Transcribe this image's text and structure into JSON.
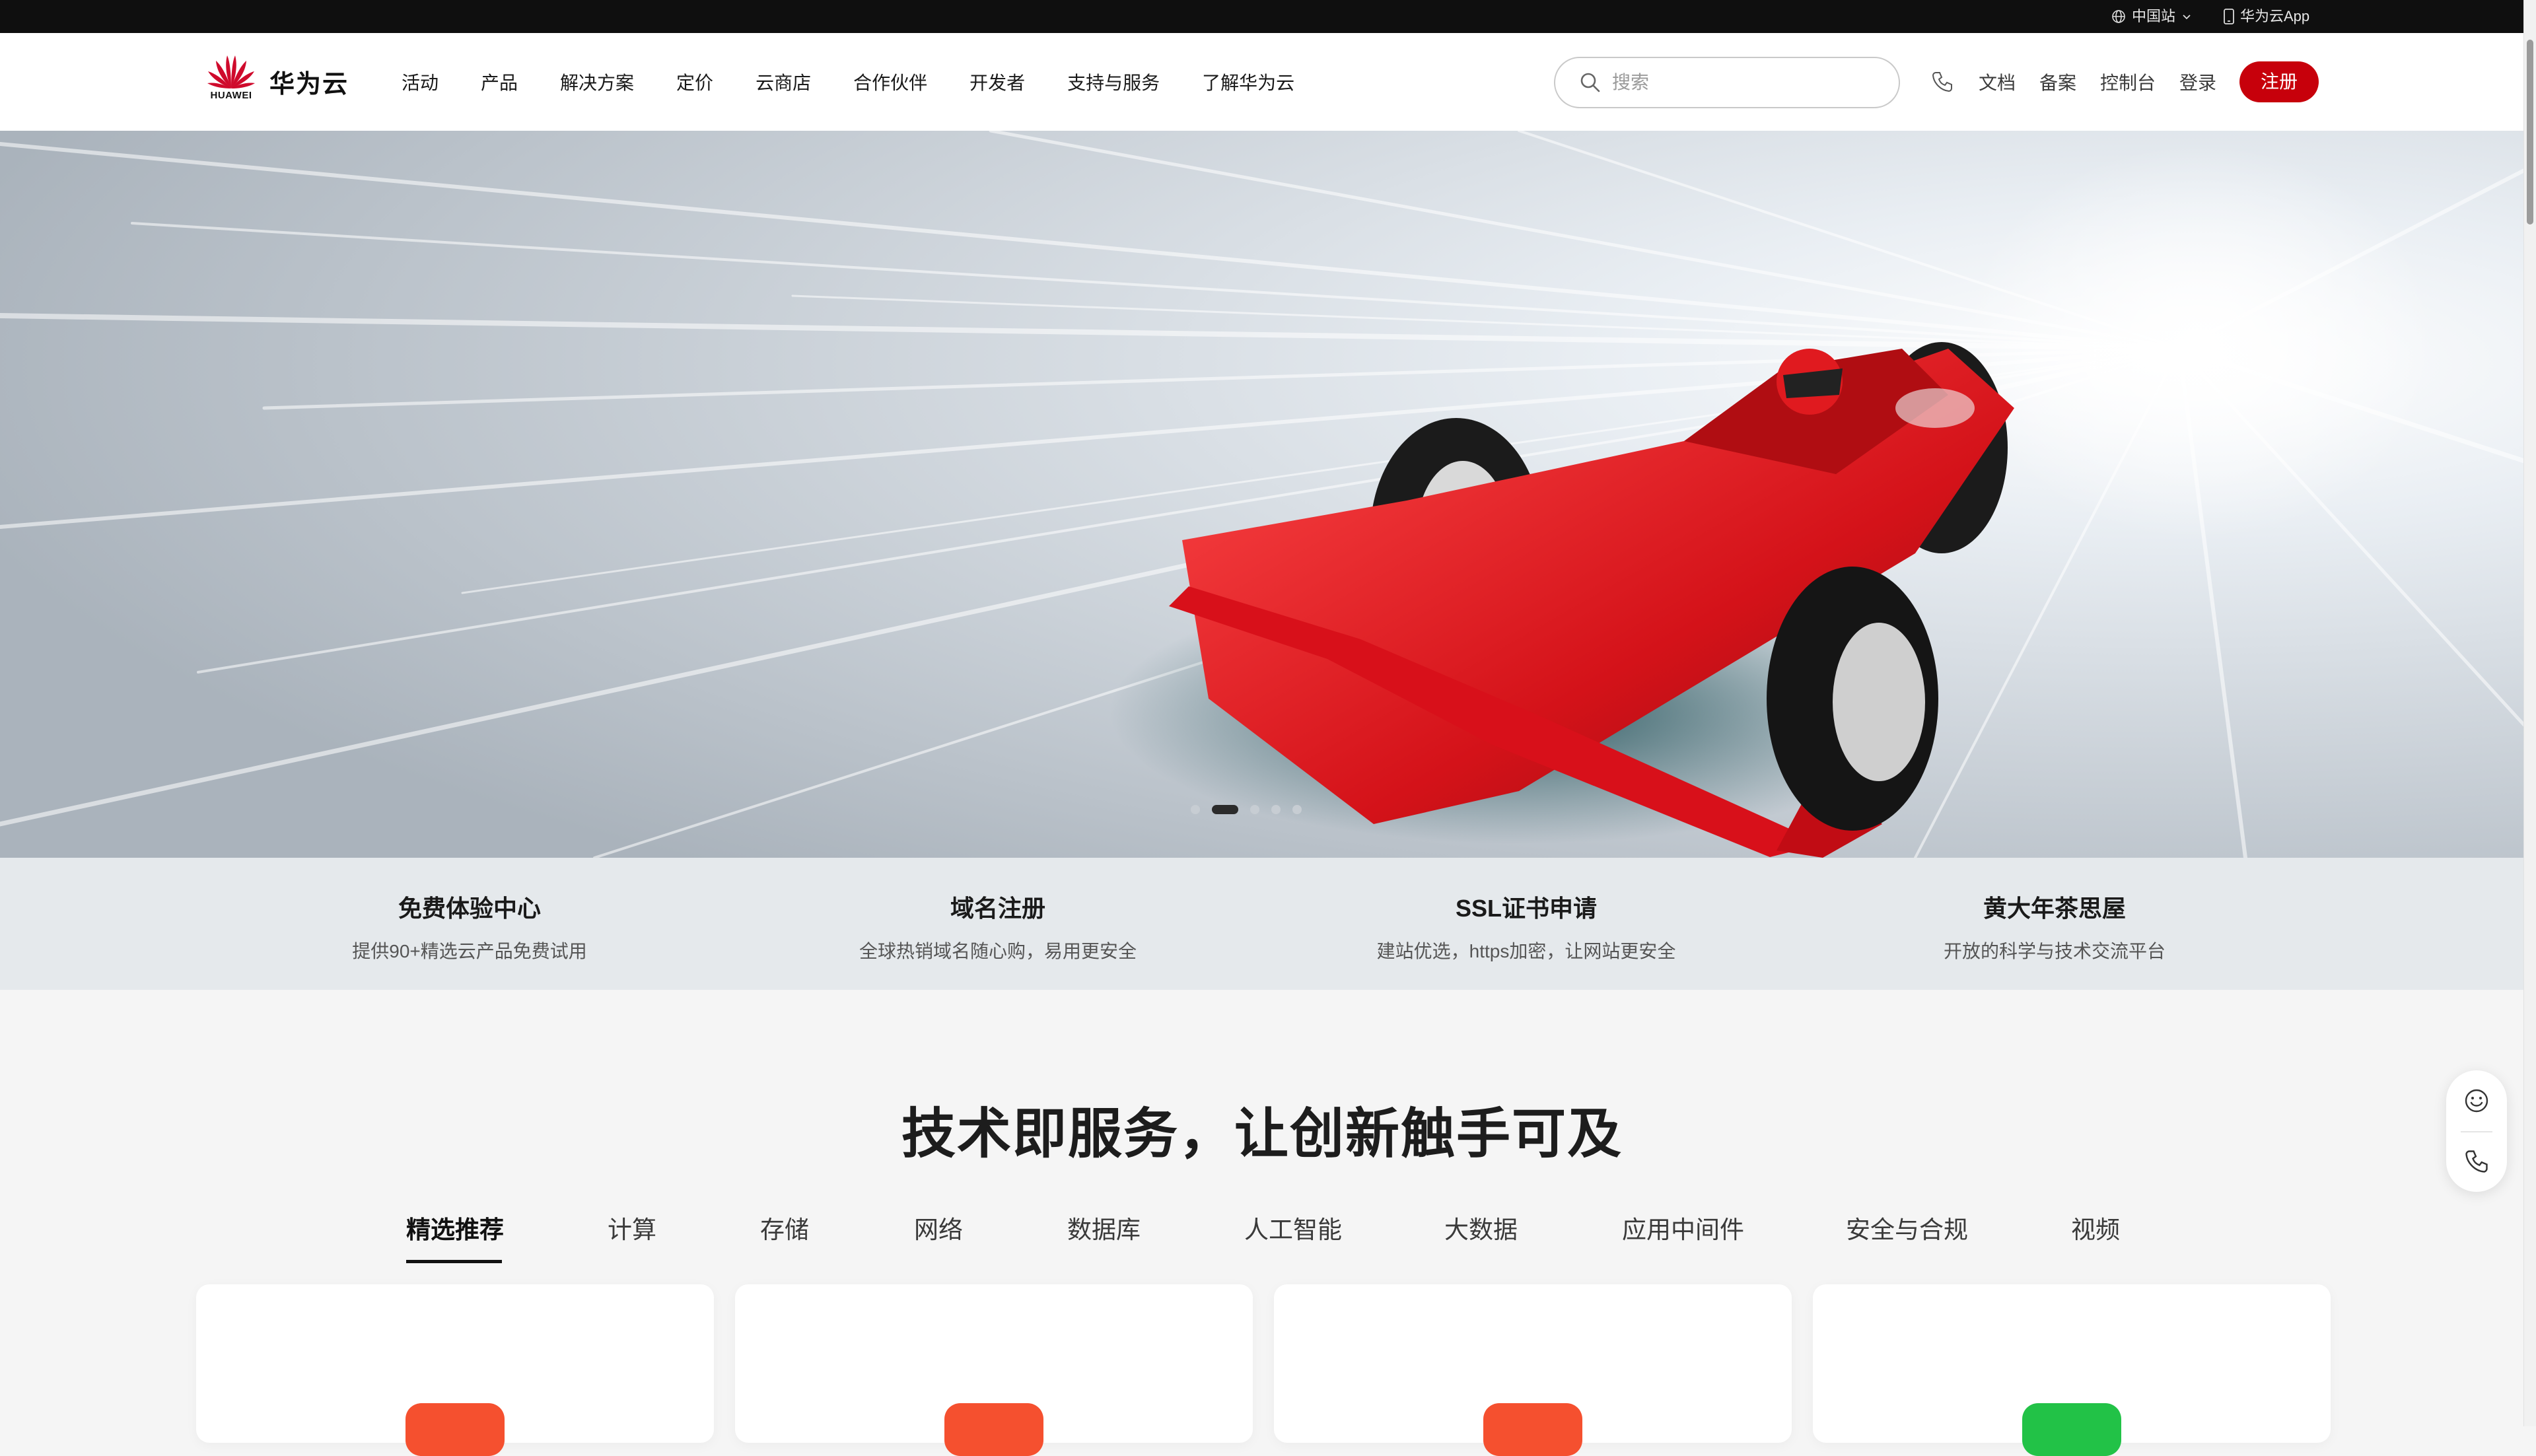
{
  "topbar": {
    "region_label": "中国站",
    "app_label": "华为云App"
  },
  "header": {
    "logo_word": "HUAWEI",
    "brand": "华为云",
    "menu": [
      "活动",
      "产品",
      "解决方案",
      "定价",
      "云商店",
      "合作伙伴",
      "开发者",
      "支持与服务",
      "了解华为云"
    ],
    "search_placeholder": "搜索",
    "links": [
      "文档",
      "备案",
      "控制台",
      "登录"
    ],
    "register": "注册"
  },
  "banner": {
    "slide_count": 5,
    "active_slide": 2
  },
  "quick_links": [
    {
      "title": "免费体验中心",
      "subtitle": "提供90+精选云产品免费试用"
    },
    {
      "title": "域名注册",
      "subtitle": "全球热销域名随心购，易用更安全"
    },
    {
      "title": "SSL证书申请",
      "subtitle": "建站优选，https加密，让网站更安全"
    },
    {
      "title": "黄大年茶思屋",
      "subtitle": "开放的科学与技术交流平台"
    }
  ],
  "section": {
    "title": "技术即服务，让创新触手可及",
    "tabs": [
      "精选推荐",
      "计算",
      "存储",
      "网络",
      "数据库",
      "人工智能",
      "大数据",
      "应用中间件",
      "安全与合规",
      "视频"
    ],
    "active_tab": 0
  },
  "colors": {
    "brand_red": "#c7000b",
    "card_badges": [
      "#f5502f",
      "#f5502f",
      "#f5502f",
      "#22c247"
    ]
  }
}
